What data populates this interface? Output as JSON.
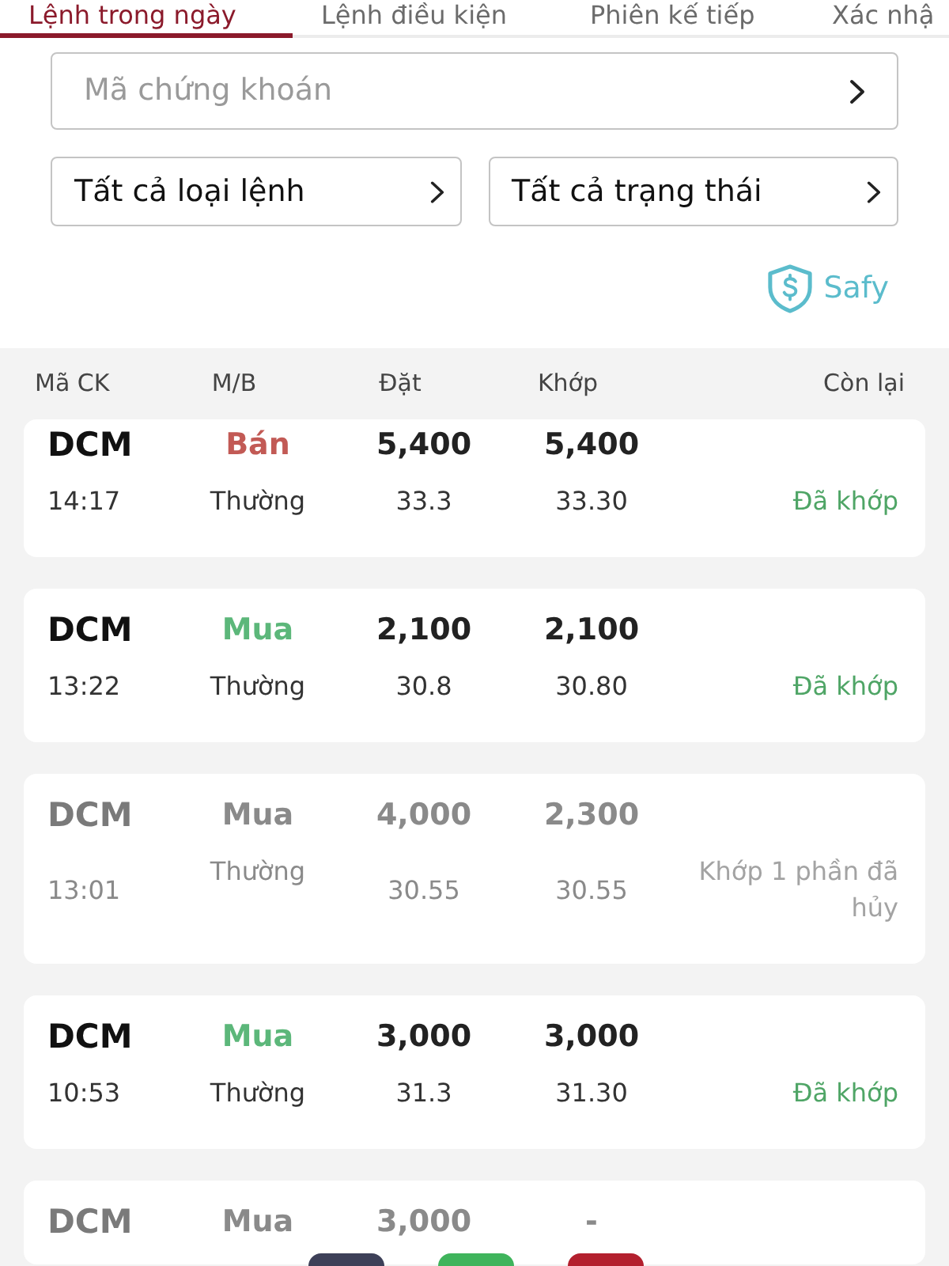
{
  "tabs": [
    {
      "label": "Lệnh trong ngày",
      "selected": true
    },
    {
      "label": "Lệnh điều kiện",
      "selected": false
    },
    {
      "label": "Phiên kế tiếp",
      "selected": false
    },
    {
      "label": "Xác nhậ",
      "selected": false
    }
  ],
  "filters": {
    "symbol": {
      "placeholder": "Mã chứng khoán"
    },
    "order_type": {
      "value": "Tất cả loại lệnh"
    },
    "status": {
      "value": "Tất cả trạng thái"
    }
  },
  "safy_button": {
    "label": "Safy"
  },
  "table": {
    "columns": [
      "Mã CK",
      "M/B",
      "Đặt",
      "Khớp",
      "Còn lại"
    ],
    "rows": [
      {
        "symbol": "DCM",
        "side": {
          "label": "Bán",
          "kind": "sell"
        },
        "quantity": "5,400",
        "matched_quantity": "5,400",
        "time": "14:17",
        "order_type": "Thường",
        "price": "33.3",
        "matched_price": "33.30",
        "status": "Đã khớp",
        "dimmed": false
      },
      {
        "symbol": "DCM",
        "side": {
          "label": "Mua",
          "kind": "buy"
        },
        "quantity": "2,100",
        "matched_quantity": "2,100",
        "time": "13:22",
        "order_type": "Thường",
        "price": "30.8",
        "matched_price": "30.80",
        "status": "Đã khớp",
        "dimmed": false
      },
      {
        "symbol": "DCM",
        "side": {
          "label": "Mua",
          "kind": "buy"
        },
        "quantity": "4,000",
        "matched_quantity": "2,300",
        "time": "13:01",
        "order_type": "Thường",
        "price": "30.55",
        "matched_price": "30.55",
        "status": "Khớp 1 phần đã hủy",
        "dimmed": true
      },
      {
        "symbol": "DCM",
        "side": {
          "label": "Mua",
          "kind": "buy"
        },
        "quantity": "3,000",
        "matched_quantity": "3,000",
        "time": "10:53",
        "order_type": "Thường",
        "price": "31.3",
        "matched_price": "31.30",
        "status": "Đã khớp",
        "dimmed": false
      },
      {
        "symbol": "DCM",
        "side": {
          "label": "Mua",
          "kind": "buy"
        },
        "quantity": "3,000",
        "matched_quantity": "-",
        "dimmed": true
      }
    ]
  },
  "floating_buttons": [
    {
      "color": "#3d4058"
    },
    {
      "color": "#3fb45c"
    },
    {
      "color": "#b3202e"
    }
  ]
}
